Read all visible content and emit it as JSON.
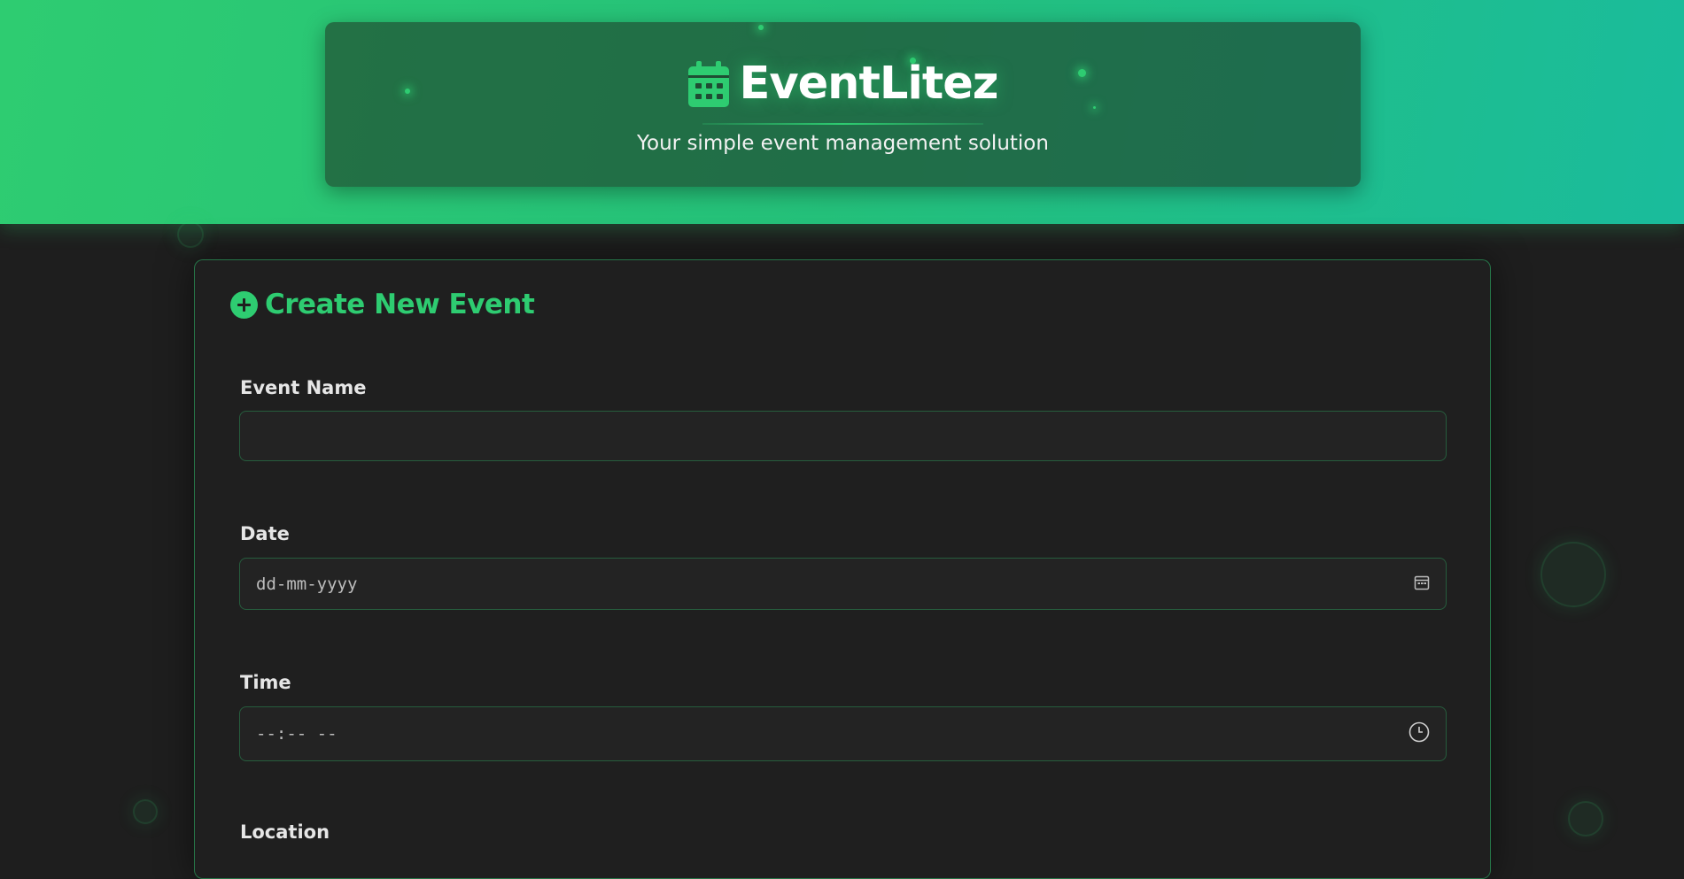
{
  "header": {
    "title": "EventLitez",
    "subtitle": "Your simple event management solution"
  },
  "form": {
    "title": "Create New Event",
    "fields": {
      "name": {
        "label": "Event Name",
        "value": ""
      },
      "date": {
        "label": "Date",
        "placeholder": "dd-mm-yyyy"
      },
      "time": {
        "label": "Time",
        "placeholder": "--:-- --"
      },
      "location": {
        "label": "Location"
      }
    }
  },
  "icons": {
    "brand": "calendar-icon",
    "form_title": "plus-circle-icon",
    "date_picker": "calendar-picker-icon",
    "time_picker": "clock-icon"
  },
  "colors": {
    "accent": "#2ecc71",
    "accent_teal": "#1abc9c",
    "background": "#1e1e1e"
  }
}
